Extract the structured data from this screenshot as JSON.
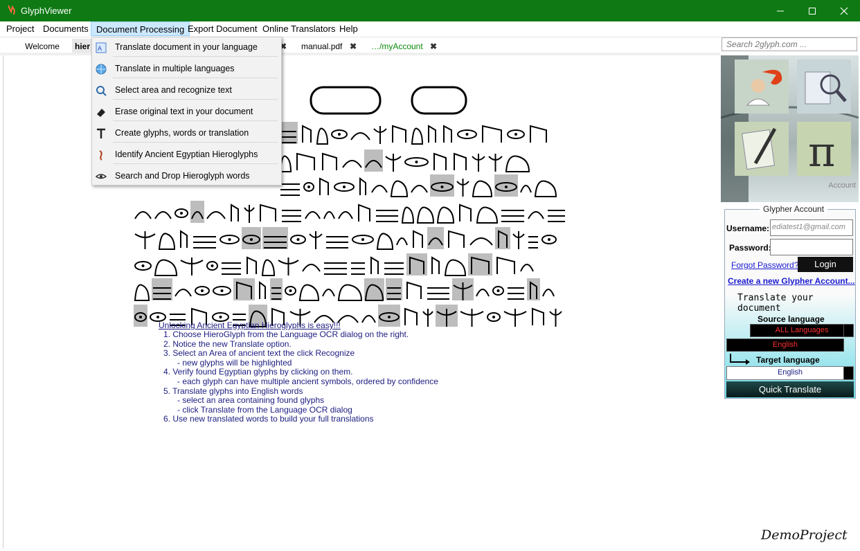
{
  "window": {
    "title": "GlyphViewer",
    "accent": "#0f7a14"
  },
  "menubar": {
    "items": [
      {
        "label": "Project"
      },
      {
        "label": "Documents"
      },
      {
        "label": "Document Processing"
      },
      {
        "label": "Export Document"
      },
      {
        "label": "Online Translators"
      },
      {
        "label": "Help"
      }
    ]
  },
  "tabs": [
    {
      "label": "Welcome"
    },
    {
      "label": "hier"
    },
    {
      "label": "manual.pdf"
    },
    {
      "label": "…/myAccount"
    }
  ],
  "search": {
    "placeholder": "Search 2glyph.com ..."
  },
  "dropdown_menu": {
    "items": [
      {
        "label": "Translate document in your language",
        "icon": "translate-icon"
      },
      {
        "label": "Translate in multiple languages",
        "icon": "globe-icon"
      },
      {
        "label": "Select area and recognize text",
        "icon": "recognize-icon"
      },
      {
        "label": "Erase original text in your document",
        "icon": "eraser-icon"
      },
      {
        "label": "Create glyphs, words or translation",
        "icon": "create-glyph-icon"
      },
      {
        "label": "Identify Ancient Egyptian Hieroglyphs",
        "icon": "identify-icon"
      },
      {
        "label": "Search and Drop Hieroglyph words",
        "icon": "search-drop-icon"
      }
    ]
  },
  "document": {
    "heading": "Unlocking Ancient Egyptian Hieroglyphs is easy!!!",
    "steps": [
      "1. Choose HieroGlyph from the Language OCR dialog on the right.",
      "2. Notice the new Translate option.",
      "3. Select an Area of ancient text the click Recognize",
      "      - new glyphs will be highlighted",
      "4. Verify found Egyptian glyphs by clicking on them.",
      "      - each glyph can have multiple ancient symbols, ordered by confidence",
      "5. Translate glyphs into English words",
      "      - select an area containing found glyphs",
      "      - click Translate from the Language OCR dialog",
      "6. Use new translated words to build your full translations"
    ],
    "footer": "DemoProject"
  },
  "right_panel": {
    "account_label": "Account"
  },
  "account": {
    "legend": "Glypher Account",
    "username_label": "Username:",
    "username_value": "ediatest1@gmail.com",
    "password_label": "Password:",
    "forgot_link": "Forgot Password?",
    "login_button": "Login",
    "create_link": "Create a new Glypher Account...",
    "translate_title": "Translate your document",
    "source_label": "Source language",
    "source_value": "ALL Languages",
    "source_value2": "English",
    "target_label": "Target language",
    "target_value": "English",
    "quick_button": "Quick Translate"
  }
}
